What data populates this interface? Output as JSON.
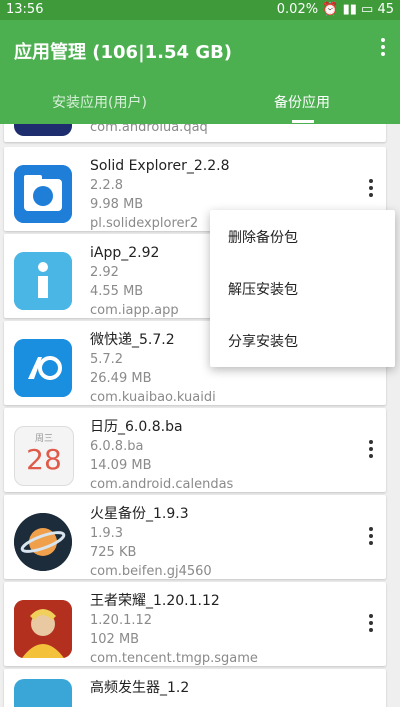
{
  "status": {
    "time": "13:56",
    "battery_pct": "0.02%",
    "battery": "45"
  },
  "appbar": {
    "title": "应用管理 (106|1.54 GB)"
  },
  "tabs": [
    {
      "label": "安装应用(用户)"
    },
    {
      "label": "备份应用"
    }
  ],
  "apps": [
    {
      "name": "",
      "version": "",
      "size": "",
      "package": "com.androlua.qaq"
    },
    {
      "name": "Solid Explorer_2.2.8",
      "version": "2.2.8",
      "size": "9.98 MB",
      "package": "pl.solidexplorer2"
    },
    {
      "name": "iApp_2.92",
      "version": "2.92",
      "size": "4.55 MB",
      "package": "com.iapp.app"
    },
    {
      "name": "微快递_5.7.2",
      "version": "5.7.2",
      "size": "26.49 MB",
      "package": "com.kuaibao.kuaidi"
    },
    {
      "name": "日历_6.0.8.ba",
      "version": "6.0.8.ba",
      "size": "14.09 MB",
      "package": "com.android.calendas"
    },
    {
      "name": "火星备份_1.9.3",
      "version": "1.9.3",
      "size": "725 KB",
      "package": "com.beifen.gj4560"
    },
    {
      "name": "王者荣耀_1.20.1.12",
      "version": "1.20.1.12",
      "size": "102 MB",
      "package": "com.tencent.tmgp.sgame"
    },
    {
      "name": "高频发生器_1.2",
      "version": "",
      "size": "",
      "package": ""
    }
  ],
  "calendar_icon": {
    "weekday": "周三",
    "day": "28"
  },
  "menu": [
    {
      "label": "删除备份包"
    },
    {
      "label": "解压安装包"
    },
    {
      "label": "分享安装包"
    }
  ],
  "colors": {
    "primary": "#4caf50",
    "statusbar": "#3f9b3a"
  }
}
